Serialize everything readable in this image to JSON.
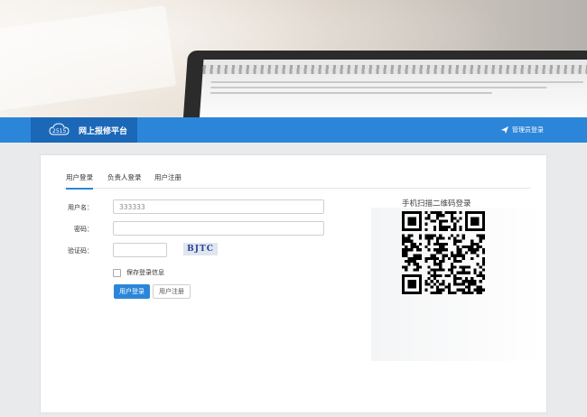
{
  "navbar": {
    "brand_title": "网上报修平台",
    "admin_link": "管理员登录"
  },
  "tabs": [
    {
      "label": "用户登录",
      "active": true
    },
    {
      "label": "负责人登录",
      "active": false
    },
    {
      "label": "用户注册",
      "active": false
    }
  ],
  "form": {
    "username_label": "用户名：",
    "username_value": "333333",
    "password_label": "密码：",
    "password_value": "",
    "captcha_label": "验证码：",
    "captcha_value": "",
    "captcha_text": "BJTC",
    "remember_label": "保存登录信息"
  },
  "buttons": {
    "login": "用户登录",
    "register": "用户注册"
  },
  "qr": {
    "title": "手机扫描二维码登录"
  },
  "colors": {
    "accent": "#2b86d9",
    "brand_bg": "#1b68b8"
  }
}
